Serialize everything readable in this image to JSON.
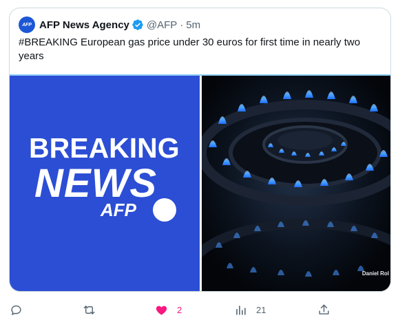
{
  "author": {
    "avatar_text": "AFP",
    "name": "AFP News Agency",
    "handle": "@AFP",
    "separator": "·",
    "time": "5m"
  },
  "tweet": {
    "text": "#BREAKING European gas price under 30 euros for first time in nearly two years"
  },
  "media": {
    "left_image": {
      "line1": "BREAKING",
      "line2": "NEWS",
      "brand": "AFP"
    },
    "right_image": {
      "credit": "Daniel Rol"
    }
  },
  "actions": {
    "reply_icon": "reply-icon",
    "retweet_icon": "retweet-icon",
    "like_icon": "heart-filled-icon",
    "like_count": "2",
    "views_icon": "views-chart-icon",
    "views_count": "21",
    "share_icon": "share-icon"
  },
  "colors": {
    "like_active": "#f91880",
    "verified": "#1d9bf0",
    "breaking_bg": "#2b4ed4",
    "muted_text": "#536471"
  }
}
